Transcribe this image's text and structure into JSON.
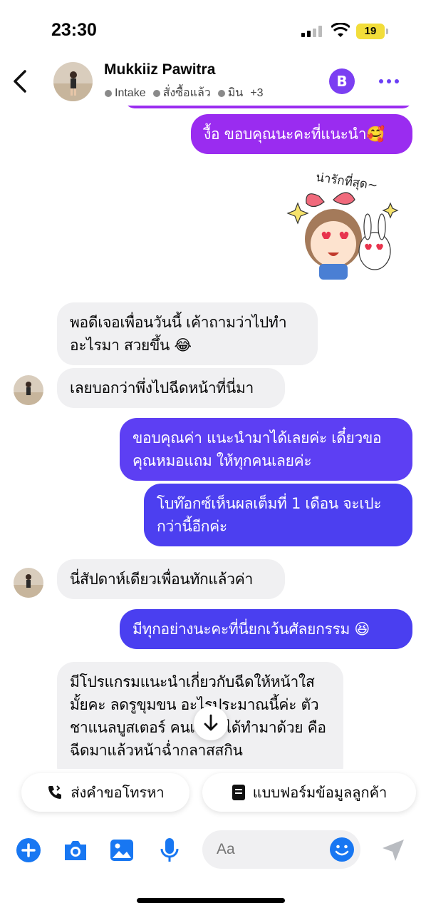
{
  "status_bar": {
    "time": "23:30",
    "battery": "19"
  },
  "header": {
    "name": "Mukkiiz Pawitra",
    "tags": [
      "Intake",
      "สั่งซื้อแล้ว",
      "มิน"
    ],
    "more_tags": "+3",
    "coin_label": "B"
  },
  "messages": [
    {
      "side": "out",
      "text": "งื้อ ขอบคุณนะคะที่แนะนำ🥰"
    },
    {
      "side": "in",
      "text": "พอดีเจอเพื่อนวันนี้ เค้าถามว่าไปทำอะไรมา สวยขึ้น 😂"
    },
    {
      "side": "in",
      "text": "เลยบอกว่าพึ่งไปฉีดหน้าที่นี่มา"
    },
    {
      "side": "out",
      "text": "ขอบคุณค่า แนะนำมาได้เลยค่ะ เดี๋ยวขอคุณหมอแถม ให้ทุกคนเลยค่ะ"
    },
    {
      "side": "out",
      "text": "โบท๊อกซ์เห็นผลเต็มที่ 1 เดือน จะเปะกว่านี้อีกค่ะ"
    },
    {
      "side": "in",
      "text": "นี่สัปดาห์เดียวเพื่อนทักแล้วค่า"
    },
    {
      "side": "out",
      "text": "มีทุกอย่างนะคะที่นี่ยกเว้นศัลยกรรม 😆"
    },
    {
      "side": "in",
      "text": "มีโปรแกรมแนะนำเกี่ยวกับฉีดให้หน้าใสมั้ยคะ ลดรูขุมขน อะไรประมาณนี้ค่ะ ตัวชาแนลบูสเตอร์ คนเซ็ทที่ได้ทำมาด้วย คือฉีดมาแล้วหน้าฉ่ำกลาสสกิน"
    }
  ],
  "sticker_text": "น่ารักที่สุด~",
  "quick_actions": [
    {
      "label": "ส่งคำขอโทรหา",
      "icon": "phone-icon"
    },
    {
      "label": "แบบฟอร์มข้อมูลลูกค้า",
      "icon": "form-icon"
    }
  ],
  "composer": {
    "placeholder": "Aa"
  },
  "colors": {
    "accent": "#6b3ff5",
    "out_top": "#8b2cf0",
    "out_bottom": "#4a3ff0",
    "in": "#f0f0f2",
    "icon_blue": "#1877f2"
  }
}
